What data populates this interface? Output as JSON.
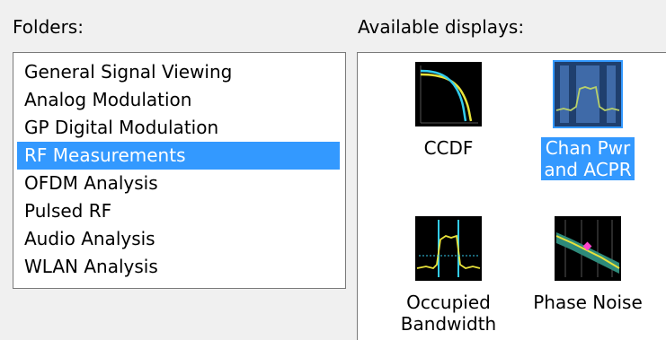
{
  "folders": {
    "label": "Folders:",
    "items": [
      {
        "label": "General Signal Viewing",
        "selected": false
      },
      {
        "label": "Analog Modulation",
        "selected": false
      },
      {
        "label": "GP Digital Modulation",
        "selected": false
      },
      {
        "label": "RF Measurements",
        "selected": true
      },
      {
        "label": "OFDM Analysis",
        "selected": false
      },
      {
        "label": "Pulsed RF",
        "selected": false
      },
      {
        "label": "Audio Analysis",
        "selected": false
      },
      {
        "label": "WLAN Analysis",
        "selected": false
      }
    ]
  },
  "displays": {
    "label": "Available displays:",
    "items": [
      {
        "lines": [
          "CCDF"
        ],
        "icon": "ccdf-icon",
        "selected": false
      },
      {
        "lines": [
          "Chan Pwr",
          "and ACPR"
        ],
        "icon": "chan-pwr-acpr-icon",
        "selected": true
      },
      {
        "lines": [
          "Occupied",
          "Bandwidth"
        ],
        "icon": "occupied-bandwidth-icon",
        "selected": false
      },
      {
        "lines": [
          "Phase Noise"
        ],
        "icon": "phase-noise-icon",
        "selected": false
      }
    ]
  },
  "colors": {
    "selection": "#3399ff",
    "trace_yellow": "#e8e23a",
    "trace_cyan": "#33ccee",
    "marker_magenta": "#ff44cc"
  }
}
